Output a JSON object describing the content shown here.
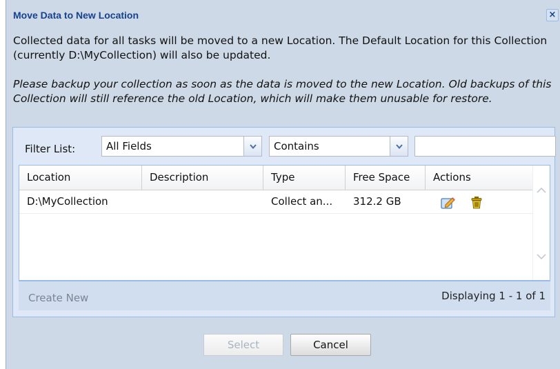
{
  "dialog": {
    "title": "Move Data to New Location",
    "close_label": "×",
    "message": "Collected data for all tasks will be moved to a new Location. The Default Location for this Collection (currently D:\\MyCollection) will also be updated.",
    "warning": "Please backup your collection as soon as the data is moved to the new Location. Old backups of this Collection will still reference the old Location, which will make them unusable for restore."
  },
  "filter": {
    "label": "Filter List:",
    "field_value": "All Fields",
    "operator_value": "Contains",
    "search_value": ""
  },
  "grid": {
    "columns": [
      "Location",
      "Description",
      "Type",
      "Free Space",
      "Actions"
    ],
    "rows": [
      {
        "location": "D:\\MyCollection",
        "description": "",
        "type": "Collect an...",
        "free_space": "312.2 GB"
      }
    ],
    "create_new_label": "Create New",
    "paging_text": "Displaying 1 - 1 of 1"
  },
  "buttons": {
    "select_label": "Select",
    "cancel_label": "Cancel"
  },
  "icons": {
    "edit": "edit-icon",
    "delete": "trash-icon",
    "dropdown": "chevron-down-icon",
    "scroll_up": "chevron-up-icon",
    "scroll_down": "chevron-down-icon"
  },
  "colors": {
    "title": "#15428b",
    "dialog_bg": "#ced9e7",
    "panel_bg": "#dfe8f6",
    "border": "#99bbe8"
  }
}
